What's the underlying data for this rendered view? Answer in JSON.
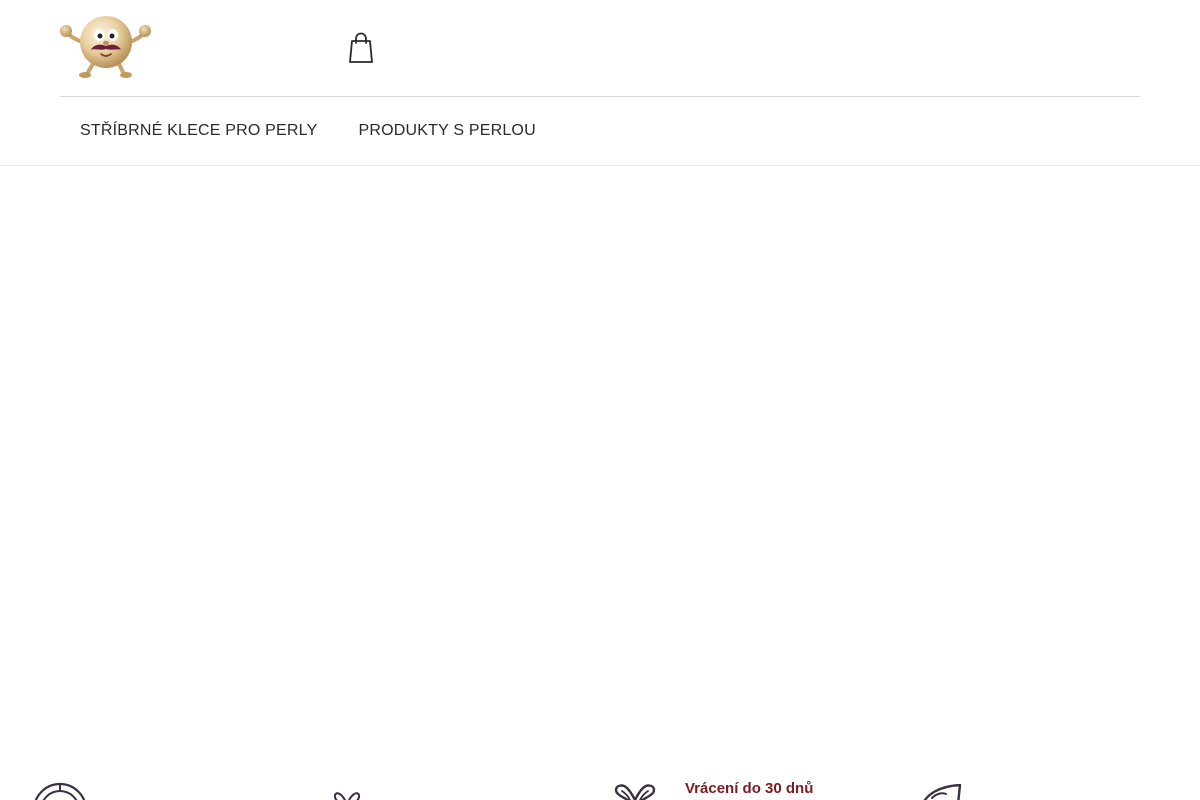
{
  "header": {
    "logo_icon": "pearl-mascot-with-mustache",
    "cart_icon": "shopping-bag-icon"
  },
  "nav": {
    "items": [
      {
        "label": "STŘÍBRNÉ KLECE PRO PERLY"
      },
      {
        "label": "PRODUKTY S PERLOU"
      }
    ]
  },
  "benefits": {
    "items": [
      {
        "icon": "badge-icon"
      },
      {
        "icon": "gift-bow-icon"
      },
      {
        "icon": "return-heart-icon",
        "title": "Vrácení do 30 dnů"
      },
      {
        "icon": "shell-icon"
      }
    ]
  },
  "colors": {
    "accent": "#7b1c22",
    "icon_stroke": "#3a2f45",
    "text": "#2a2a2a",
    "divider": "#d9d9d9"
  }
}
